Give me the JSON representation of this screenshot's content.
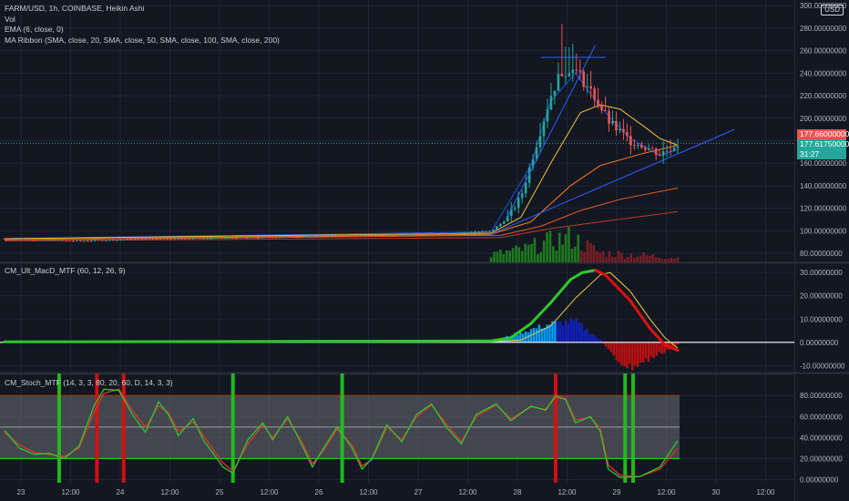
{
  "colors": {
    "background": "#131722",
    "grid": "#1f2433",
    "bull": "#26a69a",
    "bear": "#ef5350",
    "ema": "#1e53e5",
    "ma20": "#f1c232",
    "ma50": "#ff7f27",
    "ma100": "#e06020",
    "ma200": "#c0392b",
    "macd_up": "#2fc72f",
    "macd_down": "#e01010",
    "signal": "#e8d33a",
    "hist_pos": "#00a0ff",
    "hist_pos_dark": "#1020c0",
    "hist_neg": "#c01010",
    "stoch_k": "#2fc72f",
    "stoch_d": "#e0342a",
    "band_fill": "#6b6d75",
    "band_upper": "#e01010",
    "band_lower": "#2fc72f"
  },
  "main": {
    "legend": [
      "FARM/USD, 1h, COINBASE, Heikin Ashi",
      "Vol",
      "EMA (6, close, 0)",
      "MA Ribbon (SMA, close, 20, SMA, close, 50, SMA, close, 100, SMA, close, 200)"
    ],
    "price_badge": "177.66000000",
    "last_badge": "177.61750000",
    "countdown": "31:27",
    "currency": "USD"
  },
  "macd_pane": {
    "legend": "CM_Ult_MacD_MTF (60, 12, 26, 9)"
  },
  "stoch_pane": {
    "legend": "CM_Stoch_MTF (14, 3, 3, 80, 20, 60, D, 14, 3, 3)"
  },
  "chart_data": [
    {
      "type": "candlestick",
      "title": "FARM/USD, 1h, COINBASE, Heikin Ashi",
      "x_ticks": [
        "23",
        "12:00",
        "24",
        "12:00",
        "25",
        "12:00",
        "26",
        "12:00",
        "27",
        "12:00",
        "28",
        "12:00",
        "29",
        "12:00",
        "30",
        "12:00"
      ],
      "y_ticks": [
        80,
        100,
        120,
        140,
        160,
        180,
        200,
        220,
        240,
        260,
        280,
        300
      ],
      "y_tick_labels": [
        "80.00000000",
        "100.00000000",
        "120.00000000",
        "140.00000000",
        "160.00000000",
        "180.00000000",
        "200.00000000",
        "220.00000000",
        "240.00000000",
        "260.00000000",
        "280.00000000",
        "300.00000000"
      ],
      "ylim": [
        72,
        305
      ],
      "x_range_days": [
        0,
        7.7
      ],
      "candles_segments": [
        {
          "t": 0.0,
          "close": 93
        },
        {
          "t": 0.7,
          "close": 91
        },
        {
          "t": 1.5,
          "close": 93
        },
        {
          "t": 2.5,
          "close": 94
        },
        {
          "t": 3.5,
          "close": 96
        },
        {
          "t": 4.5,
          "close": 98
        },
        {
          "t": 4.9,
          "close": 100
        },
        {
          "t": 5.05,
          "close": 110
        },
        {
          "t": 5.2,
          "close": 130
        },
        {
          "t": 5.3,
          "close": 160
        },
        {
          "t": 5.4,
          "close": 190
        },
        {
          "t": 5.5,
          "close": 220
        },
        {
          "t": 5.6,
          "close": 240
        },
        {
          "t": 5.7,
          "close": 245
        },
        {
          "t": 5.8,
          "close": 237
        },
        {
          "t": 5.95,
          "close": 218
        },
        {
          "t": 6.1,
          "close": 195
        },
        {
          "t": 6.3,
          "close": 180
        },
        {
          "t": 6.5,
          "close": 173
        },
        {
          "t": 6.6,
          "close": 168
        },
        {
          "t": 6.78,
          "close": 177.6
        }
      ],
      "series": [
        {
          "name": "EMA (6, close, 0)",
          "points": [
            [
              0,
              93
            ],
            [
              4.9,
              99
            ],
            [
              5.3,
              158
            ],
            [
              5.5,
              215
            ],
            [
              5.75,
              240
            ],
            [
              6.0,
              210
            ],
            [
              6.3,
              182
            ],
            [
              6.6,
              167
            ],
            [
              6.78,
              172
            ]
          ]
        },
        {
          "name": "SMA 20",
          "points": [
            [
              0,
              93
            ],
            [
              4.9,
              98
            ],
            [
              5.2,
              112
            ],
            [
              5.5,
              160
            ],
            [
              5.8,
              205
            ],
            [
              6.0,
              212
            ],
            [
              6.2,
              208
            ],
            [
              6.45,
              192
            ],
            [
              6.6,
              182
            ],
            [
              6.78,
              176
            ]
          ]
        },
        {
          "name": "SMA 50",
          "points": [
            [
              0,
              92
            ],
            [
              4.9,
              97
            ],
            [
              5.3,
              108
            ],
            [
              5.7,
              140
            ],
            [
              6.0,
              158
            ],
            [
              6.4,
              168
            ],
            [
              6.78,
              176
            ]
          ]
        },
        {
          "name": "SMA 100",
          "points": [
            [
              0,
              92
            ],
            [
              5.0,
              96
            ],
            [
              5.4,
              104
            ],
            [
              5.8,
              118
            ],
            [
              6.2,
              128
            ],
            [
              6.78,
              138
            ]
          ]
        },
        {
          "name": "SMA 200",
          "points": [
            [
              0,
              91
            ],
            [
              5.0,
              94
            ],
            [
              5.5,
              102
            ],
            [
              6.0,
              108
            ],
            [
              6.78,
              117
            ]
          ]
        }
      ],
      "trendlines": [
        {
          "kind": "support",
          "points": [
            [
              4.9,
              97
            ],
            [
              7.35,
              190
            ]
          ]
        },
        {
          "kind": "steep",
          "points": [
            [
              5.05,
              110
            ],
            [
              5.95,
              265
            ]
          ]
        },
        {
          "kind": "resistance",
          "points": [
            [
              5.4,
              254
            ],
            [
              6.05,
              254
            ]
          ]
        }
      ],
      "volume": {
        "baseline": 72,
        "bars_segments": [
          {
            "t": 4.9,
            "v": 8
          },
          {
            "t": 5.25,
            "v": 14
          },
          {
            "t": 5.5,
            "v": 22
          },
          {
            "t": 5.7,
            "v": 26
          },
          {
            "t": 6.0,
            "v": 10
          },
          {
            "t": 6.78,
            "v": 5
          }
        ]
      },
      "last_price": 177.66
    },
    {
      "type": "line",
      "title": "CM_Ult_MacD_MTF (60, 12, 26, 9)",
      "y_ticks": [
        -10,
        0,
        10,
        20,
        30
      ],
      "y_tick_labels": [
        "-10.00000000",
        "0.00000000",
        "10.00000000",
        "20.00000000",
        "30.00000000"
      ],
      "ylim": [
        -13,
        34
      ],
      "series": [
        {
          "name": "MACD",
          "points": [
            [
              0,
              0.2
            ],
            [
              4.9,
              0.6
            ],
            [
              5.1,
              2
            ],
            [
              5.3,
              8
            ],
            [
              5.5,
              17
            ],
            [
              5.7,
              27
            ],
            [
              5.82,
              30
            ],
            [
              5.95,
              31
            ],
            [
              6.05,
              29
            ],
            [
              6.3,
              18
            ],
            [
              6.5,
              6
            ],
            [
              6.65,
              -1
            ],
            [
              6.78,
              -3.5
            ]
          ]
        },
        {
          "name": "Signal",
          "points": [
            [
              0,
              0.1
            ],
            [
              4.9,
              0.3
            ],
            [
              5.2,
              1
            ],
            [
              5.5,
              7
            ],
            [
              5.75,
              19
            ],
            [
              6.0,
              29
            ],
            [
              6.1,
              30
            ],
            [
              6.3,
              22
            ],
            [
              6.5,
              10
            ],
            [
              6.65,
              2
            ],
            [
              6.78,
              -2.5
            ]
          ]
        }
      ],
      "histogram_segments": [
        {
          "t": 4.9,
          "v": 0.3
        },
        {
          "t": 5.5,
          "v": 8
        },
        {
          "t": 5.75,
          "v": 9
        },
        {
          "t": 6.0,
          "v": 1
        },
        {
          "t": 6.15,
          "v": -7
        },
        {
          "t": 6.3,
          "v": -11
        },
        {
          "t": 6.55,
          "v": -6
        },
        {
          "t": 6.78,
          "v": -1
        }
      ],
      "zero_line": 0
    },
    {
      "type": "line",
      "title": "CM_Stoch_MTF (14, 3, 3, 80, 20, 60, D, 14, 3, 3)",
      "y_ticks": [
        0,
        20,
        40,
        60,
        80,
        100
      ],
      "y_tick_labels": [
        "0.00000000",
        "20.00000000",
        "40.00000000",
        "60.00000000",
        "80.00000000",
        "100.00000000"
      ],
      "ylim": [
        -3,
        101
      ],
      "bands": {
        "upper": 80,
        "middle": 50,
        "lower": 20
      },
      "series": [
        {
          "name": "%K",
          "points": [
            [
              0,
              47
            ],
            [
              0.15,
              30
            ],
            [
              0.3,
              24
            ],
            [
              0.45,
              25
            ],
            [
              0.6,
              20
            ],
            [
              0.75,
              32
            ],
            [
              0.9,
              70
            ],
            [
              1.0,
              86
            ],
            [
              1.15,
              85
            ],
            [
              1.3,
              60
            ],
            [
              1.42,
              45
            ],
            [
              1.55,
              74
            ],
            [
              1.65,
              62
            ],
            [
              1.75,
              42
            ],
            [
              1.9,
              58
            ],
            [
              2.0,
              38
            ],
            [
              2.2,
              12
            ],
            [
              2.3,
              6
            ],
            [
              2.45,
              38
            ],
            [
              2.6,
              54
            ],
            [
              2.7,
              38
            ],
            [
              2.85,
              60
            ],
            [
              3.0,
              32
            ],
            [
              3.1,
              12
            ],
            [
              3.2,
              28
            ],
            [
              3.35,
              50
            ],
            [
              3.5,
              30
            ],
            [
              3.6,
              10
            ],
            [
              3.7,
              20
            ],
            [
              3.85,
              52
            ],
            [
              4.0,
              36
            ],
            [
              4.15,
              62
            ],
            [
              4.3,
              72
            ],
            [
              4.45,
              50
            ],
            [
              4.6,
              34
            ],
            [
              4.75,
              62
            ],
            [
              4.95,
              72
            ],
            [
              5.1,
              56
            ],
            [
              5.3,
              70
            ],
            [
              5.45,
              66
            ],
            [
              5.55,
              80
            ],
            [
              5.65,
              76
            ],
            [
              5.75,
              54
            ],
            [
              5.9,
              60
            ],
            [
              6.0,
              46
            ],
            [
              6.08,
              10
            ],
            [
              6.2,
              2
            ],
            [
              6.4,
              3
            ],
            [
              6.6,
              12
            ],
            [
              6.78,
              37
            ]
          ]
        },
        {
          "name": "%D",
          "points": [
            [
              0,
              45
            ],
            [
              0.15,
              33
            ],
            [
              0.3,
              26
            ],
            [
              0.45,
              24
            ],
            [
              0.6,
              22
            ],
            [
              0.75,
              30
            ],
            [
              0.9,
              64
            ],
            [
              1.0,
              82
            ],
            [
              1.15,
              86
            ],
            [
              1.3,
              64
            ],
            [
              1.42,
              50
            ],
            [
              1.55,
              70
            ],
            [
              1.65,
              64
            ],
            [
              1.75,
              46
            ],
            [
              1.9,
              55
            ],
            [
              2.0,
              42
            ],
            [
              2.2,
              16
            ],
            [
              2.3,
              8
            ],
            [
              2.45,
              34
            ],
            [
              2.6,
              52
            ],
            [
              2.7,
              40
            ],
            [
              2.85,
              58
            ],
            [
              3.0,
              35
            ],
            [
              3.1,
              15
            ],
            [
              3.2,
              26
            ],
            [
              3.35,
              48
            ],
            [
              3.5,
              33
            ],
            [
              3.6,
              13
            ],
            [
              3.7,
              19
            ],
            [
              3.85,
              50
            ],
            [
              4.0,
              38
            ],
            [
              4.15,
              60
            ],
            [
              4.3,
              71
            ],
            [
              4.45,
              53
            ],
            [
              4.6,
              36
            ],
            [
              4.75,
              60
            ],
            [
              4.95,
              71
            ],
            [
              5.1,
              58
            ],
            [
              5.3,
              69
            ],
            [
              5.45,
              67
            ],
            [
              5.55,
              78
            ],
            [
              5.65,
              77
            ],
            [
              5.75,
              57
            ],
            [
              5.9,
              59
            ],
            [
              6.0,
              49
            ],
            [
              6.08,
              14
            ],
            [
              6.2,
              4
            ],
            [
              6.4,
              3
            ],
            [
              6.6,
              10
            ],
            [
              6.78,
              30
            ]
          ]
        }
      ],
      "signal_bars": [
        {
          "t": 0.55,
          "kind": "buy"
        },
        {
          "t": 0.93,
          "kind": "sell"
        },
        {
          "t": 1.2,
          "kind": "sell"
        },
        {
          "t": 2.3,
          "kind": "buy"
        },
        {
          "t": 3.4,
          "kind": "buy"
        },
        {
          "t": 5.55,
          "kind": "sell"
        },
        {
          "t": 6.25,
          "kind": "buy"
        },
        {
          "t": 6.33,
          "kind": "buy"
        }
      ]
    }
  ]
}
